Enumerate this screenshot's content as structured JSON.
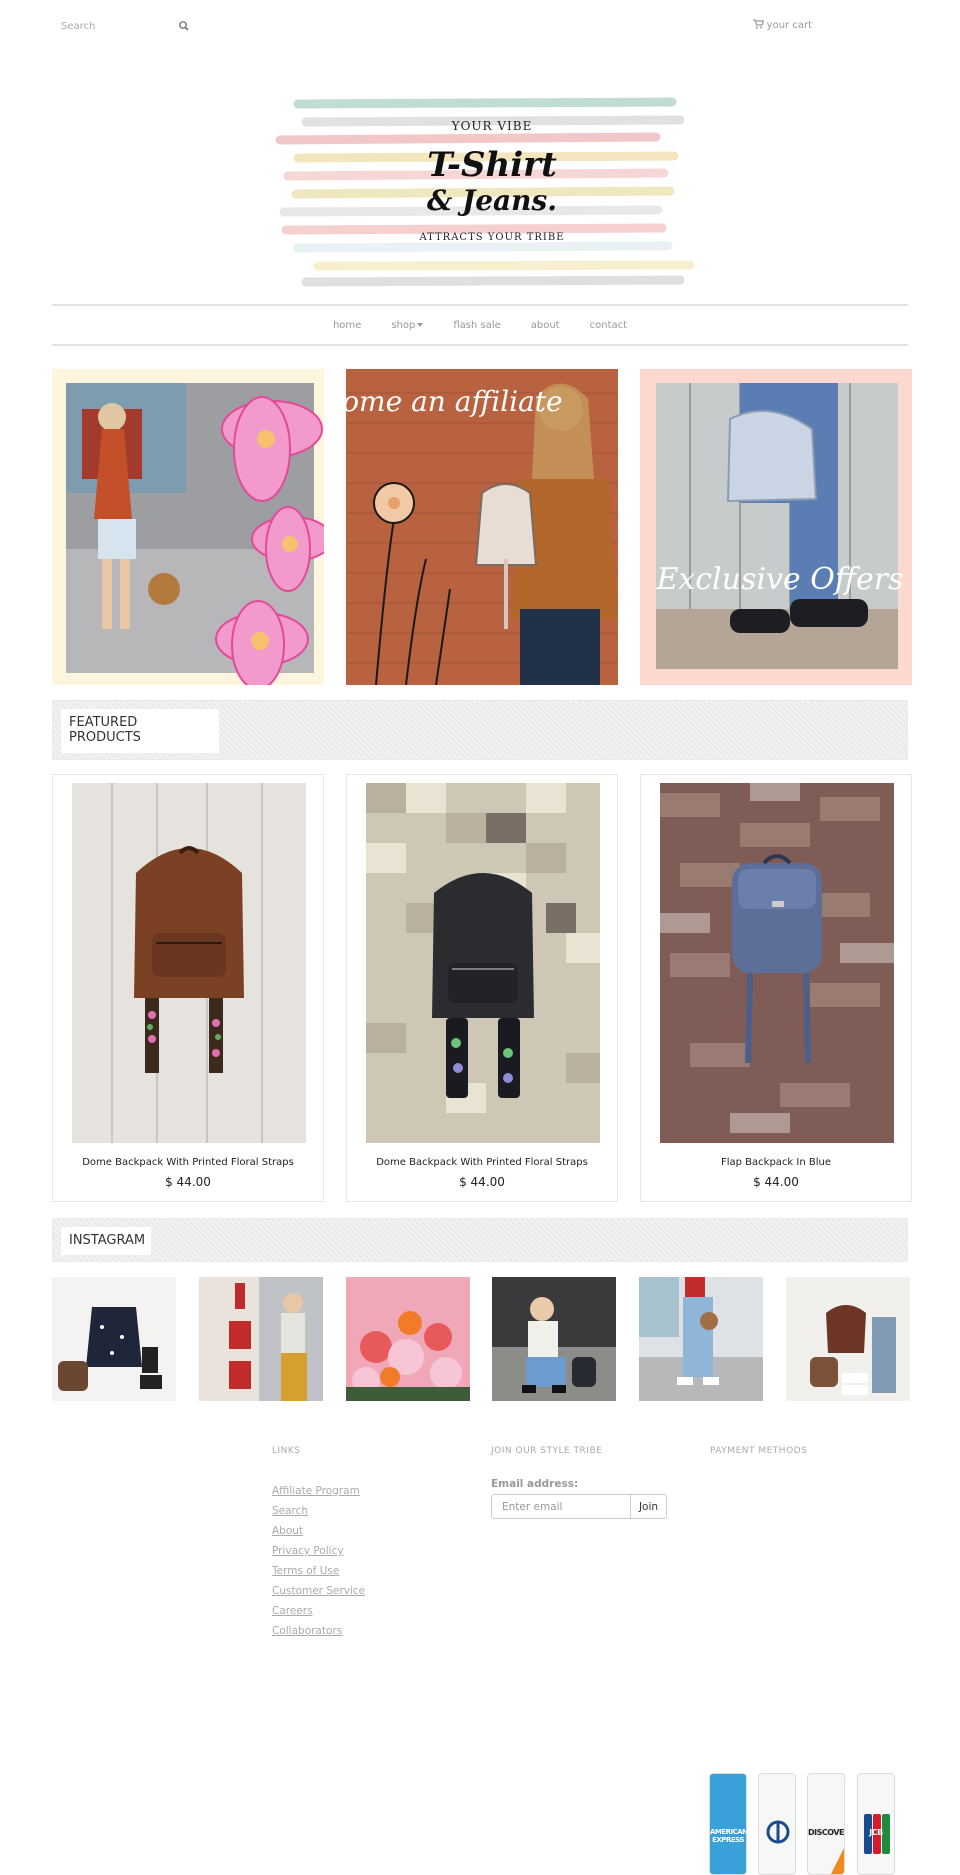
{
  "header": {
    "search_placeholder": "Search",
    "search_icon": "search-icon",
    "cart_icon": "cart-icon",
    "cart_label": "your cart"
  },
  "logo": {
    "line1": "YOUR VIBE",
    "line2": "T-Shirt",
    "line3": "& Jeans.",
    "line4": "ATTRACTS YOUR TRIBE"
  },
  "nav": {
    "items": [
      "home",
      "shop",
      "flash sale",
      "about",
      "contact"
    ]
  },
  "promos": [
    {
      "image": "girl-with-pink-flowers",
      "text": ""
    },
    {
      "image": "girl-with-backpack-wood-wall",
      "text": "Become an affiliate"
    },
    {
      "image": "backpack-exclusive-offers",
      "text": "Exclusive Offers"
    }
  ],
  "featured": {
    "title": "FEATURED PRODUCTS",
    "products": [
      {
        "name": "Dome Backpack With Printed Floral Straps",
        "price": "$ 44.00",
        "color": "#7a4125"
      },
      {
        "name": "Dome Backpack With Printed Floral Straps",
        "price": "$ 44.00",
        "color": "#2b2c30"
      },
      {
        "name": "Flap Backpack In Blue",
        "price": "$ 44.00",
        "color": "#5d6f99"
      }
    ]
  },
  "instagram": {
    "title": "INSTAGRAM"
  },
  "footer": {
    "links_heading": "LINKS",
    "links": [
      "Affiliate Program",
      "Search",
      "About",
      "Privacy Policy",
      "Terms of Use",
      "Customer Service",
      "Careers",
      "Collaborators"
    ],
    "newsletter_heading": "JOIN OUR STYLE TRIBE",
    "email_label": "Email address:",
    "email_placeholder": "Enter email",
    "join_label": "Join",
    "payment_heading": "PAYMENT METHODS",
    "payment_cards": [
      "AMERICAN EXPRESS",
      "DINERS CLUB",
      "DISCOVER",
      "JCB"
    ]
  },
  "colors": {
    "accent_gray": "#999999",
    "border": "#e3e3e3"
  }
}
